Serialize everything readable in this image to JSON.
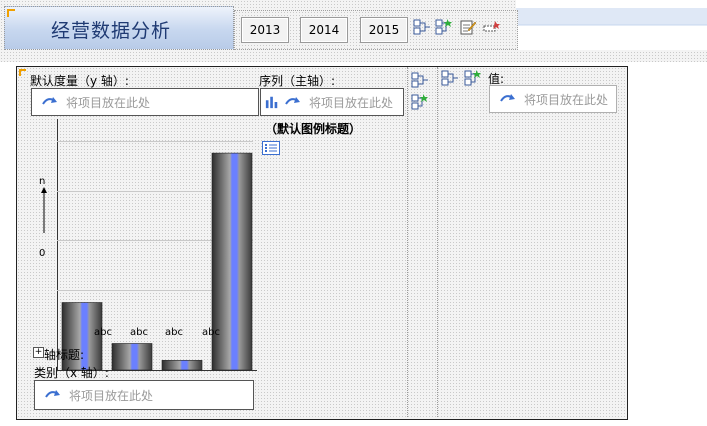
{
  "header": {
    "title": "经营数据分析",
    "year_buttons": [
      "2013",
      "2014",
      "2015"
    ],
    "icons": [
      "link-icon",
      "add-series-icon",
      "edit-icon",
      "move-icon"
    ]
  },
  "chart_panel": {
    "y_axis_label": "默认度量（y 轴）:",
    "y_drop_placeholder": "将项目放在此处",
    "series_label": "序列（主轴）:",
    "series_drop_placeholder": "将项目放在此处",
    "legend_title": "（默认图例标题）",
    "axis_title_label": "轴标题:",
    "category_label": "类别（x 轴）:",
    "category_drop_placeholder": "将项目放在此处",
    "value_label": "值:",
    "value_drop_placeholder": "将项目放在此处"
  },
  "chart_data": {
    "type": "bar",
    "categories": [
      "abc",
      "abc",
      "abc",
      "abc"
    ],
    "values": [
      28,
      11,
      4,
      90
    ],
    "y_tick_labels": [
      "n",
      "0"
    ],
    "ylim": [
      0,
      100
    ],
    "grid": true,
    "colors": {
      "bar_dark": "#3a3a3a",
      "bar_light": "#9a9a9a",
      "bar_accent": "#6b80ff"
    }
  }
}
